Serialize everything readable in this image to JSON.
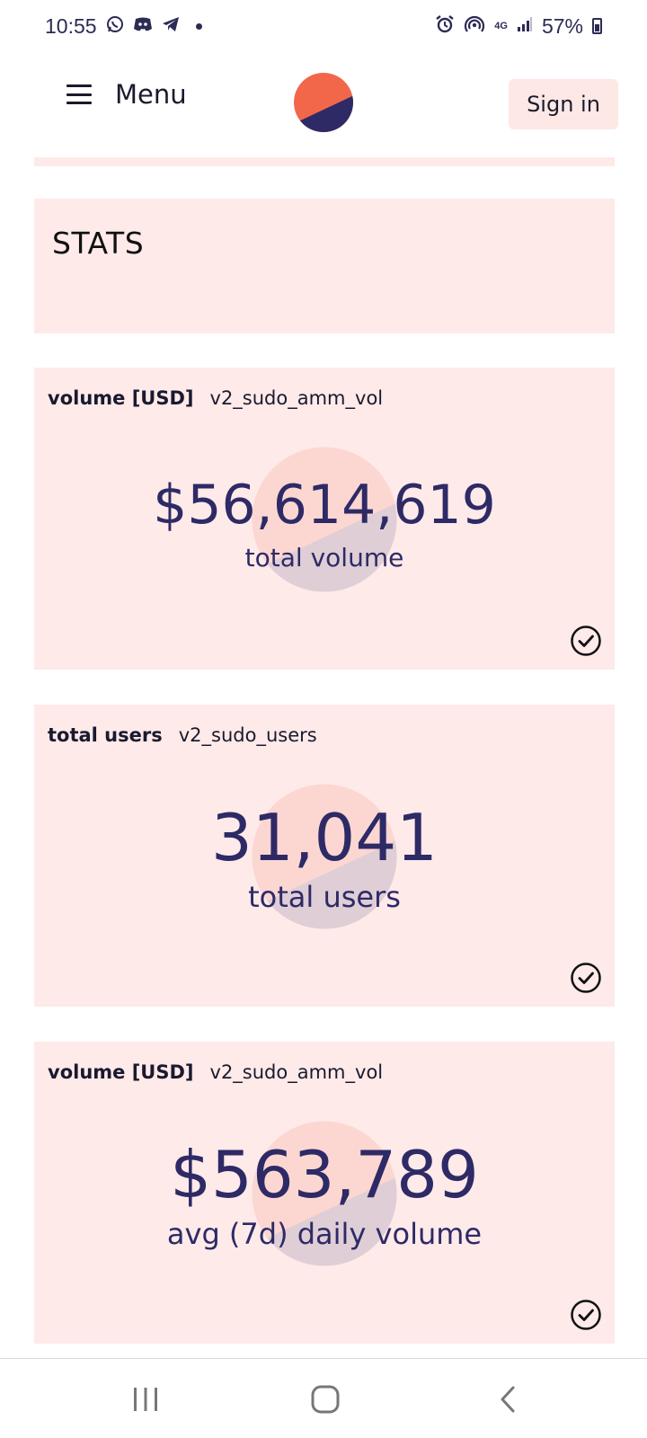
{
  "status_bar": {
    "time": "10:55",
    "battery": "57%",
    "network": "4G",
    "left_icons": [
      "whatsapp-icon",
      "discord-icon",
      "telegram-icon",
      "notification-dot-icon"
    ],
    "right_icons": [
      "alarm-icon",
      "hotspot-icon",
      "network-4g-icon",
      "signal-icon",
      "battery-icon"
    ]
  },
  "header": {
    "menu_label": "Menu",
    "signin_label": "Sign in",
    "logo_colors": {
      "top": "#f2674a",
      "bottom": "#2e2a66"
    }
  },
  "stats_section": {
    "title": "STATS"
  },
  "metrics": [
    {
      "name": "volume [USD]",
      "source": "v2_sudo_amm_vol",
      "value": "$56,614,619",
      "caption": "total volume",
      "status_icon": "check-circle-icon"
    },
    {
      "name": "total users",
      "source": "v2_sudo_users",
      "value": "31,041",
      "caption": "total users",
      "status_icon": "check-circle-icon"
    },
    {
      "name": "volume [USD]",
      "source": "v2_sudo_amm_vol",
      "value": "$563,789",
      "caption": "avg (7d) daily volume",
      "status_icon": "check-circle-icon"
    }
  ],
  "nav_bar": {
    "buttons": [
      "recents-icon",
      "home-icon",
      "back-icon"
    ]
  },
  "colors": {
    "card_bg": "#feeae9",
    "accent_text": "#2e2a66",
    "brand_orange": "#f2674a"
  }
}
